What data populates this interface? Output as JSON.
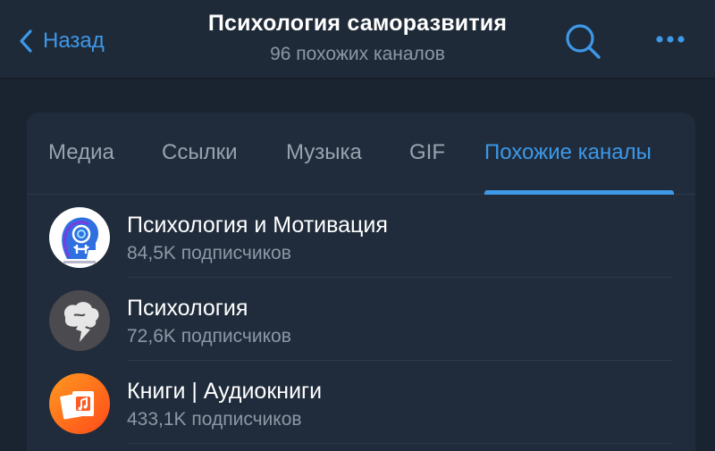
{
  "header": {
    "back_label": "Назад",
    "title": "Психология саморазвития",
    "subtitle": "96 похожих каналов"
  },
  "tabs": [
    {
      "label": "Медиа"
    },
    {
      "label": "Ссылки"
    },
    {
      "label": "Музыка"
    },
    {
      "label": "GIF"
    },
    {
      "label": "Похожие каналы",
      "active": true
    }
  ],
  "channels": [
    {
      "name": "Психология и Мотивация",
      "subscribers": "84,5K подписчиков",
      "avatar_icon": "head-spiral-logo-icon"
    },
    {
      "name": "Психология",
      "subscribers": "72,6K подписчиков",
      "avatar_icon": "brain-lightning-icon"
    },
    {
      "name": "Книги | Аудиокниги",
      "subscribers": "433,1K подписчиков",
      "avatar_icon": "books-music-icon"
    }
  ],
  "colors": {
    "accent": "#3d98e8",
    "background": "#1a2330",
    "header": "#1f2a38",
    "card": "#202c3b",
    "secondary_text": "#8c98a5"
  }
}
